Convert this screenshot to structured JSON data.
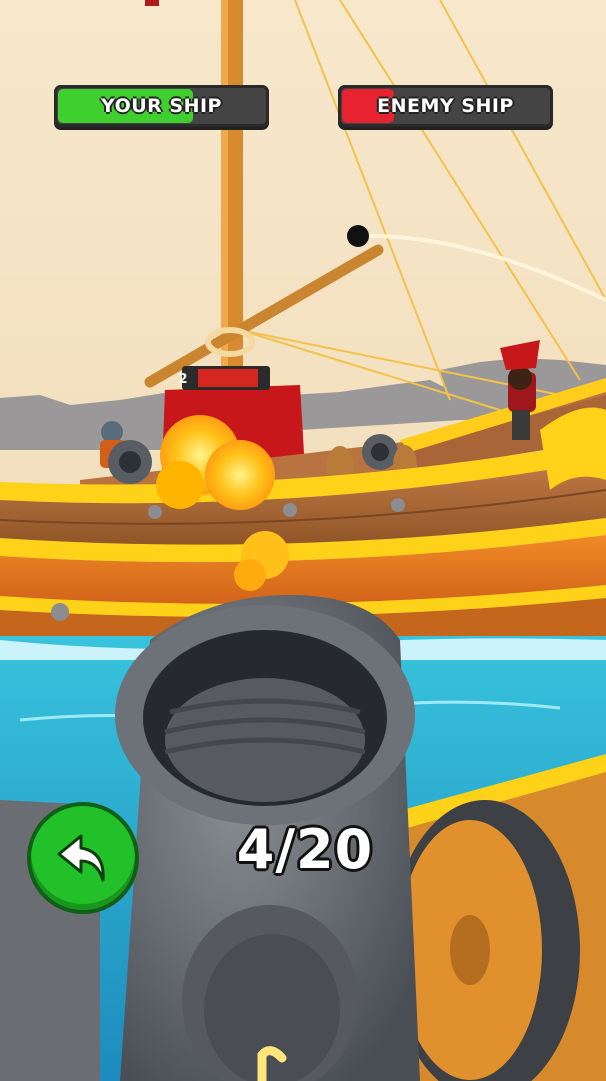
{
  "hud": {
    "your_ship": {
      "label": "YOUR SHIP",
      "health_fraction": 0.65,
      "color": "#3fcf2e"
    },
    "enemy_ship": {
      "label": "ENEMY SHIP",
      "health_fraction": 0.25,
      "color": "#e8222e"
    }
  },
  "ammo": {
    "text": "4/20"
  },
  "undo_button": {
    "icon": "undo-arrow-icon",
    "color": "#22c12a"
  },
  "enemy_pirate": {
    "level": "2"
  }
}
